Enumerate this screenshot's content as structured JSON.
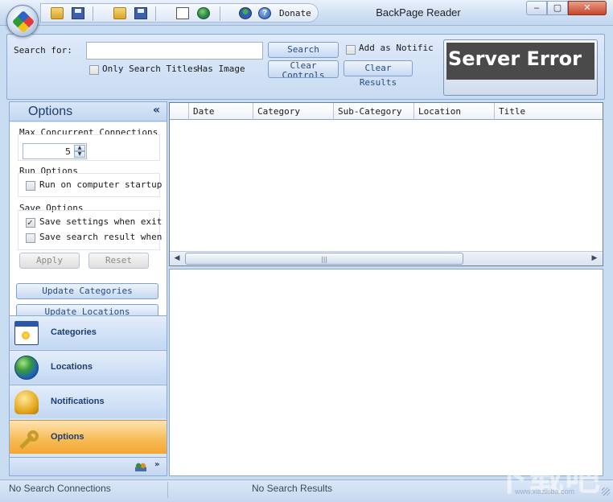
{
  "window": {
    "title": "BackPage Reader",
    "minimize": "‒",
    "maximize": "▢",
    "close": "✕"
  },
  "quick_toolbar": {
    "donate_label": "Donate",
    "icons": [
      "open-folder-icon",
      "save-icon",
      "open-folder-icon",
      "save-icon",
      "document-icon",
      "globe-icon",
      "user-icon",
      "help-icon"
    ]
  },
  "search": {
    "label": "Search for:",
    "input_value": "",
    "only_titles_label": "Only Search Titles",
    "has_image_label": "Has Image",
    "search_button": "Search",
    "clear_controls_button": "Clear Controls",
    "add_notification_label": "Add as Notific",
    "clear_results_button": "Clear Results"
  },
  "banner": {
    "text": "Server Error"
  },
  "options": {
    "title": "Options",
    "collapse_glyph": "«",
    "max_connections_title": "Max Concurrent Connections",
    "max_connections_value": "5",
    "run_options_title": "Run Options",
    "run_on_startup_label": "Run on computer startup",
    "run_on_startup_checked": false,
    "save_options_title": "Save Options",
    "save_settings_label": "Save settings when exit",
    "save_settings_checked": true,
    "save_results_label": "Save search result when exit",
    "save_results_checked": false,
    "apply_button": "Apply",
    "reset_button": "Reset",
    "update_categories_button": "Update Categories",
    "update_locations_button": "Update Locations"
  },
  "nav": {
    "items": [
      {
        "label": "Categories",
        "icon": "calendar-icon",
        "active": false
      },
      {
        "label": "Locations",
        "icon": "globe-icon",
        "active": false
      },
      {
        "label": "Notifications",
        "icon": "bell-icon",
        "active": false
      },
      {
        "label": "Options",
        "icon": "key-icon",
        "active": true
      }
    ],
    "footer_chevron": "»"
  },
  "grid": {
    "columns": [
      "",
      "Date",
      "Category",
      "Sub-Category",
      "Location",
      "Title"
    ],
    "rows": []
  },
  "status": {
    "left": "No Search Connections",
    "center": "No Search Results"
  },
  "watermark": {
    "main": "下载吧",
    "sub": "www.xiazaiba.com"
  },
  "colors": {
    "accent": "#254b84",
    "active_nav": "#f7bd58",
    "panel_bg": "#d6e4f5"
  }
}
